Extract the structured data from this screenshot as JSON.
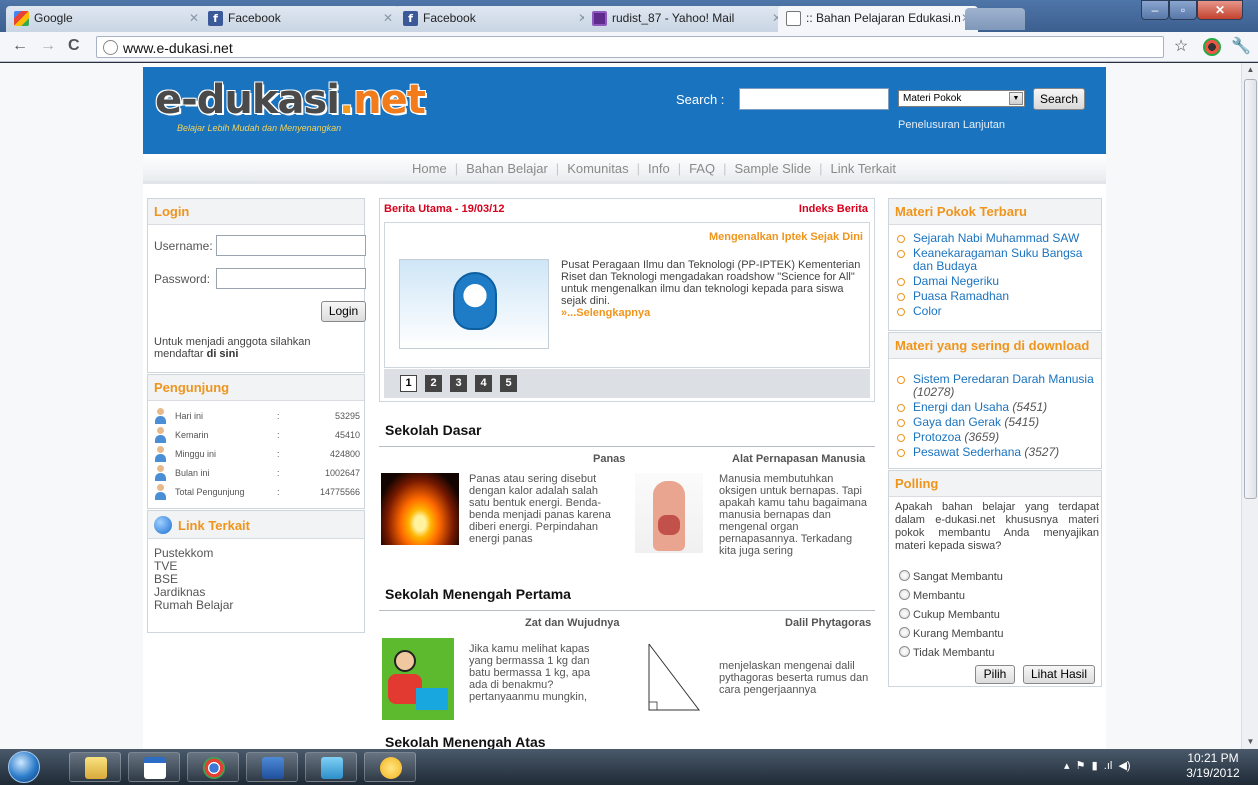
{
  "browser": {
    "tabs": [
      {
        "title": "Google",
        "icon": "google-icon",
        "active": false
      },
      {
        "title": "Facebook",
        "icon": "facebook-icon",
        "active": false
      },
      {
        "title": "Facebook",
        "icon": "facebook-icon",
        "active": false
      },
      {
        "title": "rudist_87 - Yahoo! Mail",
        "icon": "yahoo-mail-icon",
        "active": false
      },
      {
        "title": ":: Bahan Pelajaran Edukasi.n",
        "icon": "page-icon",
        "active": true
      }
    ],
    "url": "www.e-dukasi.net"
  },
  "header": {
    "logo_main": "e-dukasi",
    "logo_dot": ".",
    "logo_net": "net",
    "tagline": "Belajar Lebih Mudah dan Menyenangkan",
    "search_label": "Search :",
    "search_value": "",
    "search_category": "Materi Pokok",
    "search_button": "Search",
    "advanced_search": "Penelusuran Lanjutan"
  },
  "menu": [
    "Home",
    "Bahan Belajar",
    "Komunitas",
    "Info",
    "FAQ",
    "Sample Slide",
    "Link Terkait"
  ],
  "login": {
    "title": "Login",
    "username_label": "Username:",
    "password_label": "Password:",
    "button": "Login",
    "note": "Untuk menjadi anggota silahkan mendaftar",
    "note_link": "di sini"
  },
  "visitors": {
    "title": "Pengunjung",
    "rows": [
      {
        "label": "Hari ini",
        "value": "53295"
      },
      {
        "label": "Kemarin",
        "value": "45410"
      },
      {
        "label": "Minggu ini",
        "value": "424800"
      },
      {
        "label": "Bulan ini",
        "value": "1002647"
      },
      {
        "label": "Total Pengunjung",
        "value": "14775566"
      }
    ],
    "colon": ":"
  },
  "links": {
    "title": "Link Terkait",
    "items": [
      "Pustekkom",
      "TVE",
      "BSE",
      "Jardiknas",
      "Rumah Belajar"
    ]
  },
  "news": {
    "head_left": "Berita Utama - 19/03/12",
    "head_right": "Indeks Berita",
    "title": "Mengenalkan Iptek Sejak Dini",
    "text": "Pusat Peragaan Ilmu dan Teknologi (PP-IPTEK) Kementerian Riset dan Teknologi mengadakan roadshow \"Science for All\" untuk mengenalkan ilmu dan teknologi kepada para siswa sejak dini.",
    "more": "»...Selengkapnya",
    "pages": [
      "1",
      "2",
      "3",
      "4",
      "5"
    ]
  },
  "sections": {
    "sd": {
      "title": "Sekolah Dasar",
      "a1_title": "Panas",
      "a1_text": "Panas atau sering disebut dengan kalor adalah salah satu bentuk energi. Benda-benda menjadi panas karena diberi energi. Perpindahan energi panas",
      "a2_title": "Alat Pernapasan Manusia",
      "a2_text": "Manusia membutuhkan oksigen untuk bernapas. Tapi apakah kamu tahu bagaimana manusia bernapas dan mengenal organ pernapasannya. Terkadang kita juga sering"
    },
    "smp": {
      "title": "Sekolah Menengah Pertama",
      "a1_title": "Zat dan Wujudnya",
      "a1_text": "Jika kamu melihat kapas yang bermassa 1 kg dan batu bermassa 1 kg, apa ada di benakmu? pertanyaanmu mungkin,",
      "a2_title": "Dalil Phytagoras",
      "a2_text": "menjelaskan mengenai dalil pythagoras beserta rumus dan cara pengerjaannya"
    },
    "sma": {
      "title": "Sekolah Menengah Atas"
    }
  },
  "materi_terbaru": {
    "title": "Materi Pokok Terbaru",
    "items": [
      "Sejarah Nabi Muhammad SAW",
      "Keanekaragaman Suku Bangsa dan Budaya",
      "Damai Negeriku",
      "Puasa Ramadhan",
      "Color"
    ]
  },
  "downloads": {
    "title": "Materi yang sering di download",
    "items": [
      {
        "name": "Sistem Peredaran Darah Manusia",
        "count": "(10278)"
      },
      {
        "name": "Energi dan Usaha",
        "count": "(5451)"
      },
      {
        "name": "Gaya dan Gerak",
        "count": "(5415)"
      },
      {
        "name": "Protozoa",
        "count": "(3659)"
      },
      {
        "name": "Pesawat Sederhana",
        "count": "(3527)"
      }
    ]
  },
  "poll": {
    "title": "Polling",
    "question": "Apakah bahan belajar yang terdapat dalam e-dukasi.net khususnya materi pokok membantu Anda menyajikan materi kepada siswa?",
    "options": [
      "Sangat Membantu",
      "Membantu",
      "Cukup Membantu",
      "Kurang Membantu",
      "Tidak Membantu"
    ],
    "vote_button": "Pilih",
    "results_button": "Lihat Hasil"
  },
  "taskbar": {
    "time": "10:21 PM",
    "date": "3/19/2012"
  }
}
